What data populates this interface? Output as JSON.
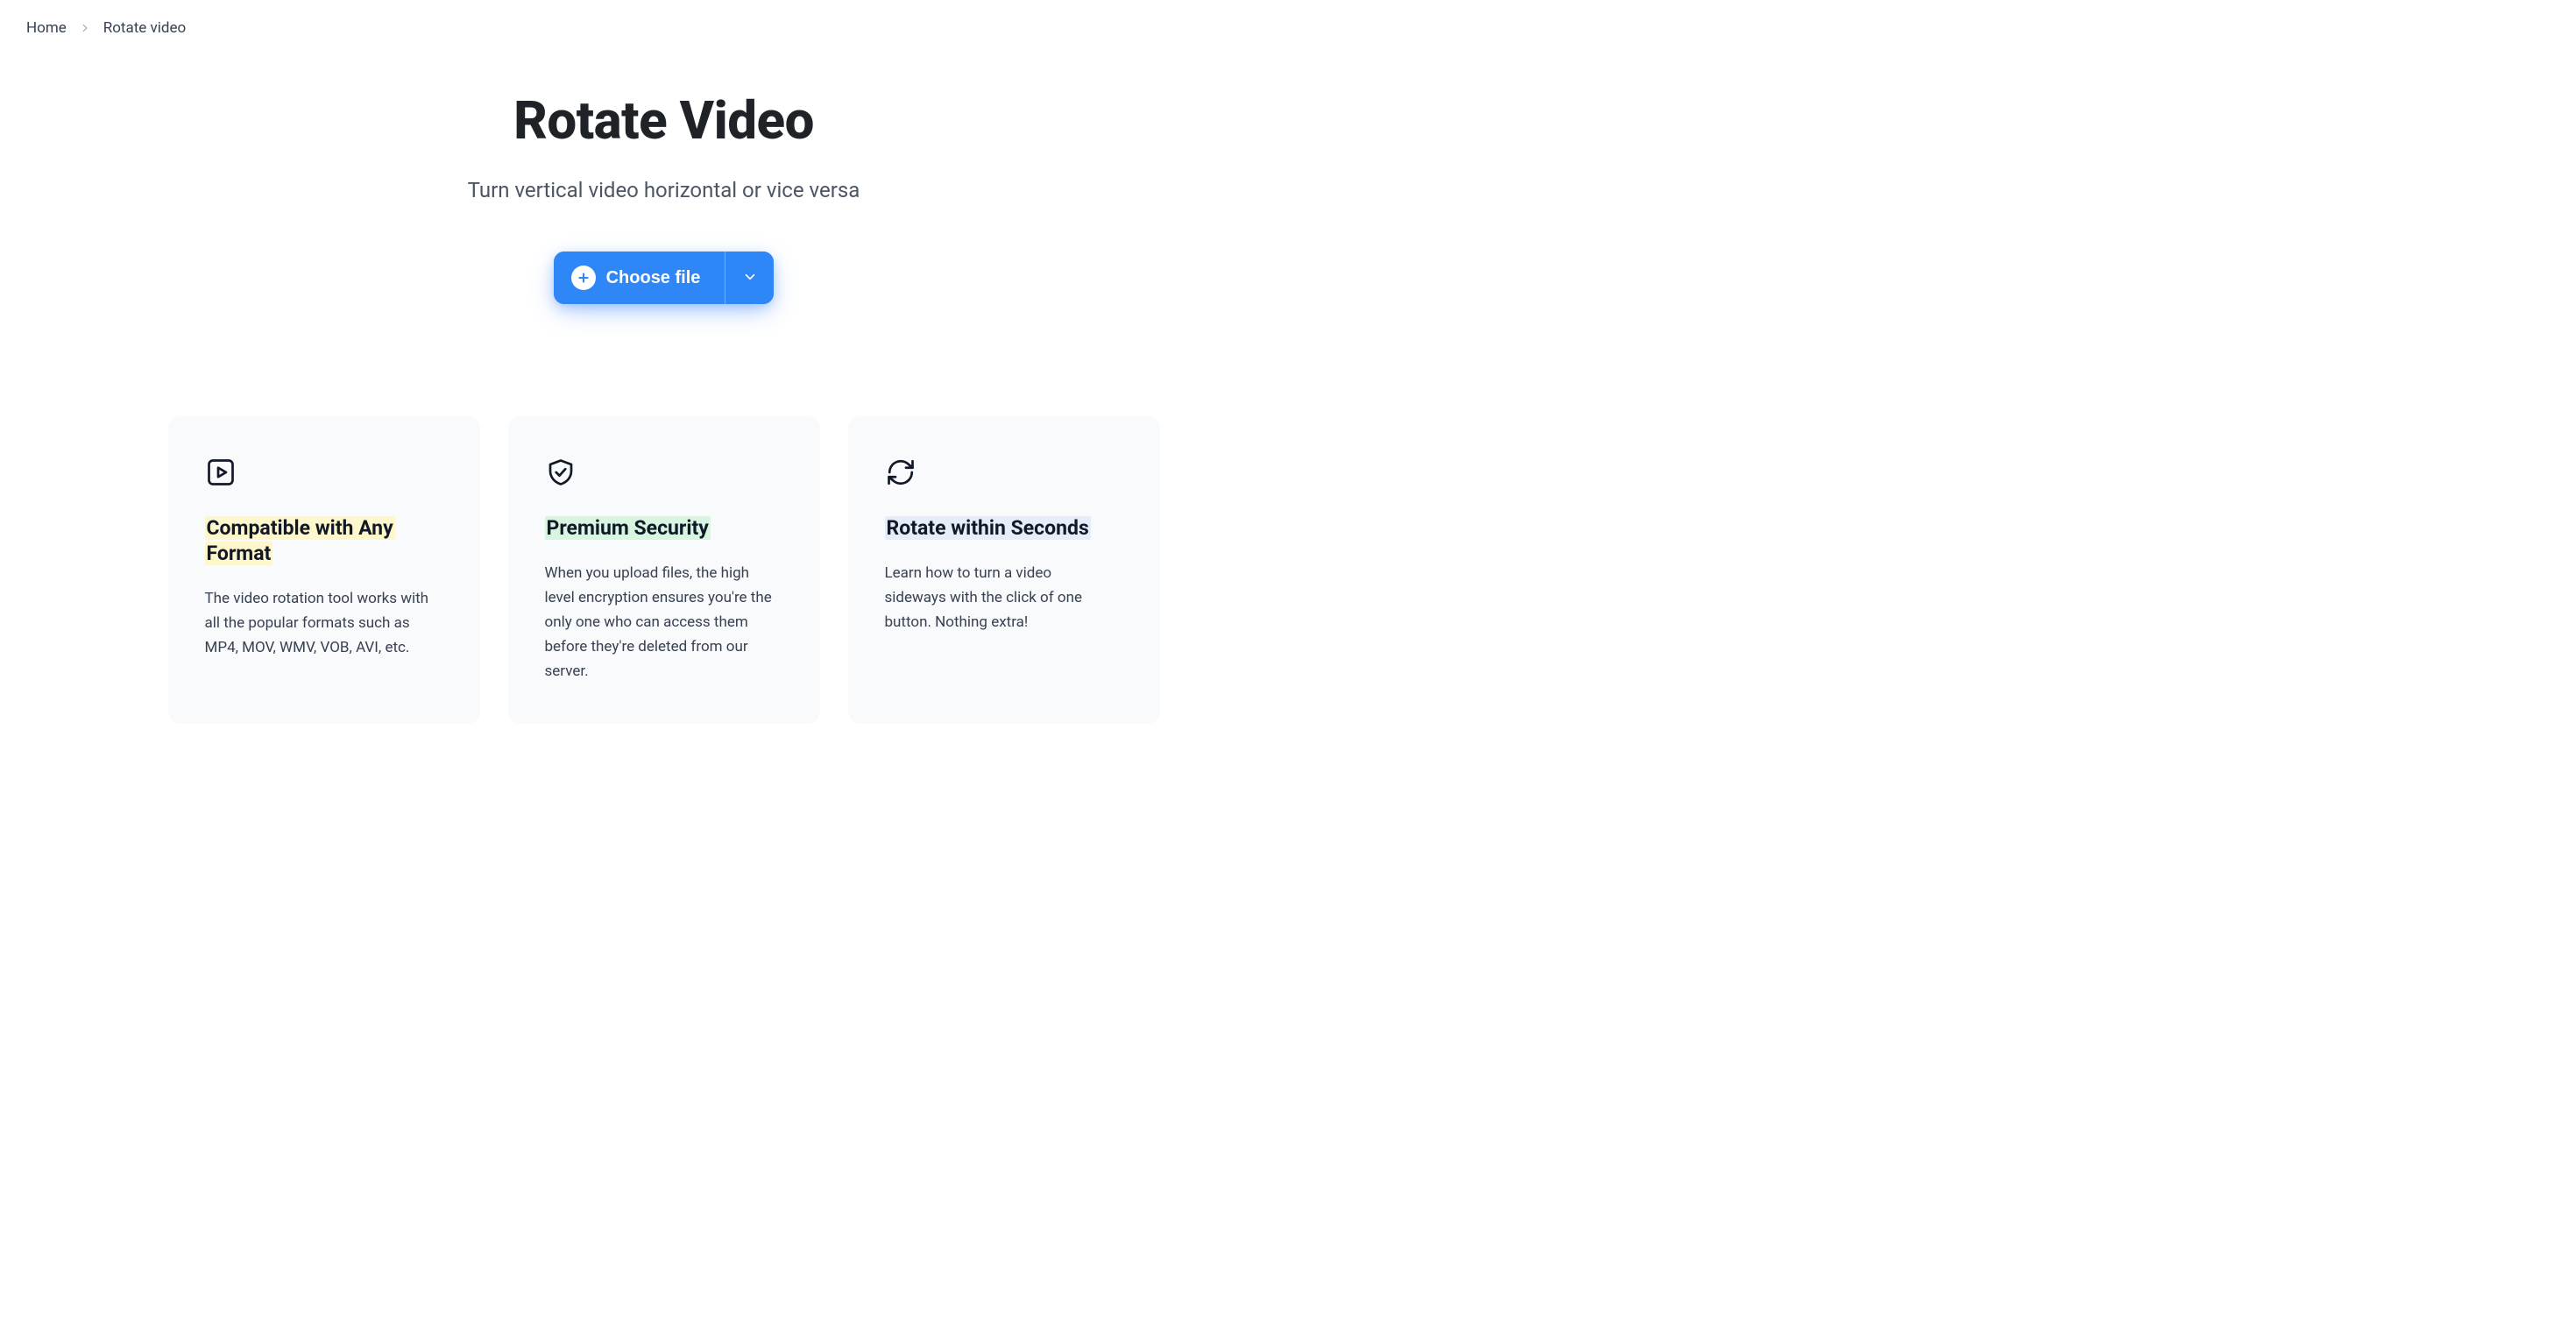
{
  "breadcrumb": {
    "home": "Home",
    "current": "Rotate video"
  },
  "hero": {
    "title": "Rotate Video",
    "subtitle": "Turn vertical video horizontal or vice versa"
  },
  "upload": {
    "button_label": "Choose file"
  },
  "features": [
    {
      "icon": "play-square-icon",
      "highlight": "yellow",
      "title": "Compatible with Any Format",
      "desc": "The video rotation tool works with all the popular formats such as MP4, MOV, WMV, VOB, AVI, etc."
    },
    {
      "icon": "shield-check-icon",
      "highlight": "green",
      "title": "Premium Security",
      "desc": "When you upload files, the high level encryption ensures you're the only one who can access them before they're deleted from our server."
    },
    {
      "icon": "refresh-icon",
      "highlight": "blue",
      "title": "Rotate within Seconds",
      "desc": "Learn how to turn a video sideways with the click of one button. Nothing extra!"
    }
  ]
}
